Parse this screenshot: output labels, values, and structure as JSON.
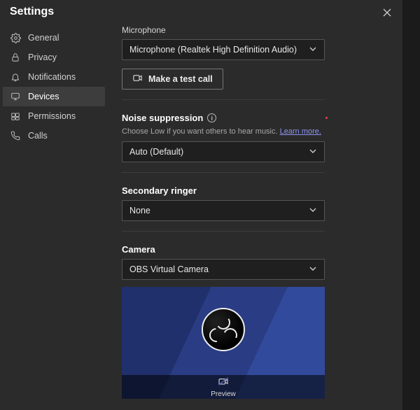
{
  "panel": {
    "title": "Settings"
  },
  "sidebar": {
    "items": [
      {
        "label": "General",
        "icon": "gear"
      },
      {
        "label": "Privacy",
        "icon": "lock"
      },
      {
        "label": "Notifications",
        "icon": "bell"
      },
      {
        "label": "Devices",
        "icon": "monitor",
        "active": true
      },
      {
        "label": "Permissions",
        "icon": "key"
      },
      {
        "label": "Calls",
        "icon": "phone"
      }
    ]
  },
  "microphone": {
    "label": "Microphone",
    "selected": "Microphone (Realtek High Definition Audio)",
    "test_call": "Make a test call"
  },
  "noise": {
    "title": "Noise suppression",
    "help": "Choose Low if you want others to hear music.",
    "learn_more": "Learn more.",
    "selected": "Auto (Default)"
  },
  "ringer": {
    "title": "Secondary ringer",
    "selected": "None"
  },
  "camera": {
    "title": "Camera",
    "selected": "OBS Virtual Camera",
    "preview_label": "Preview"
  }
}
